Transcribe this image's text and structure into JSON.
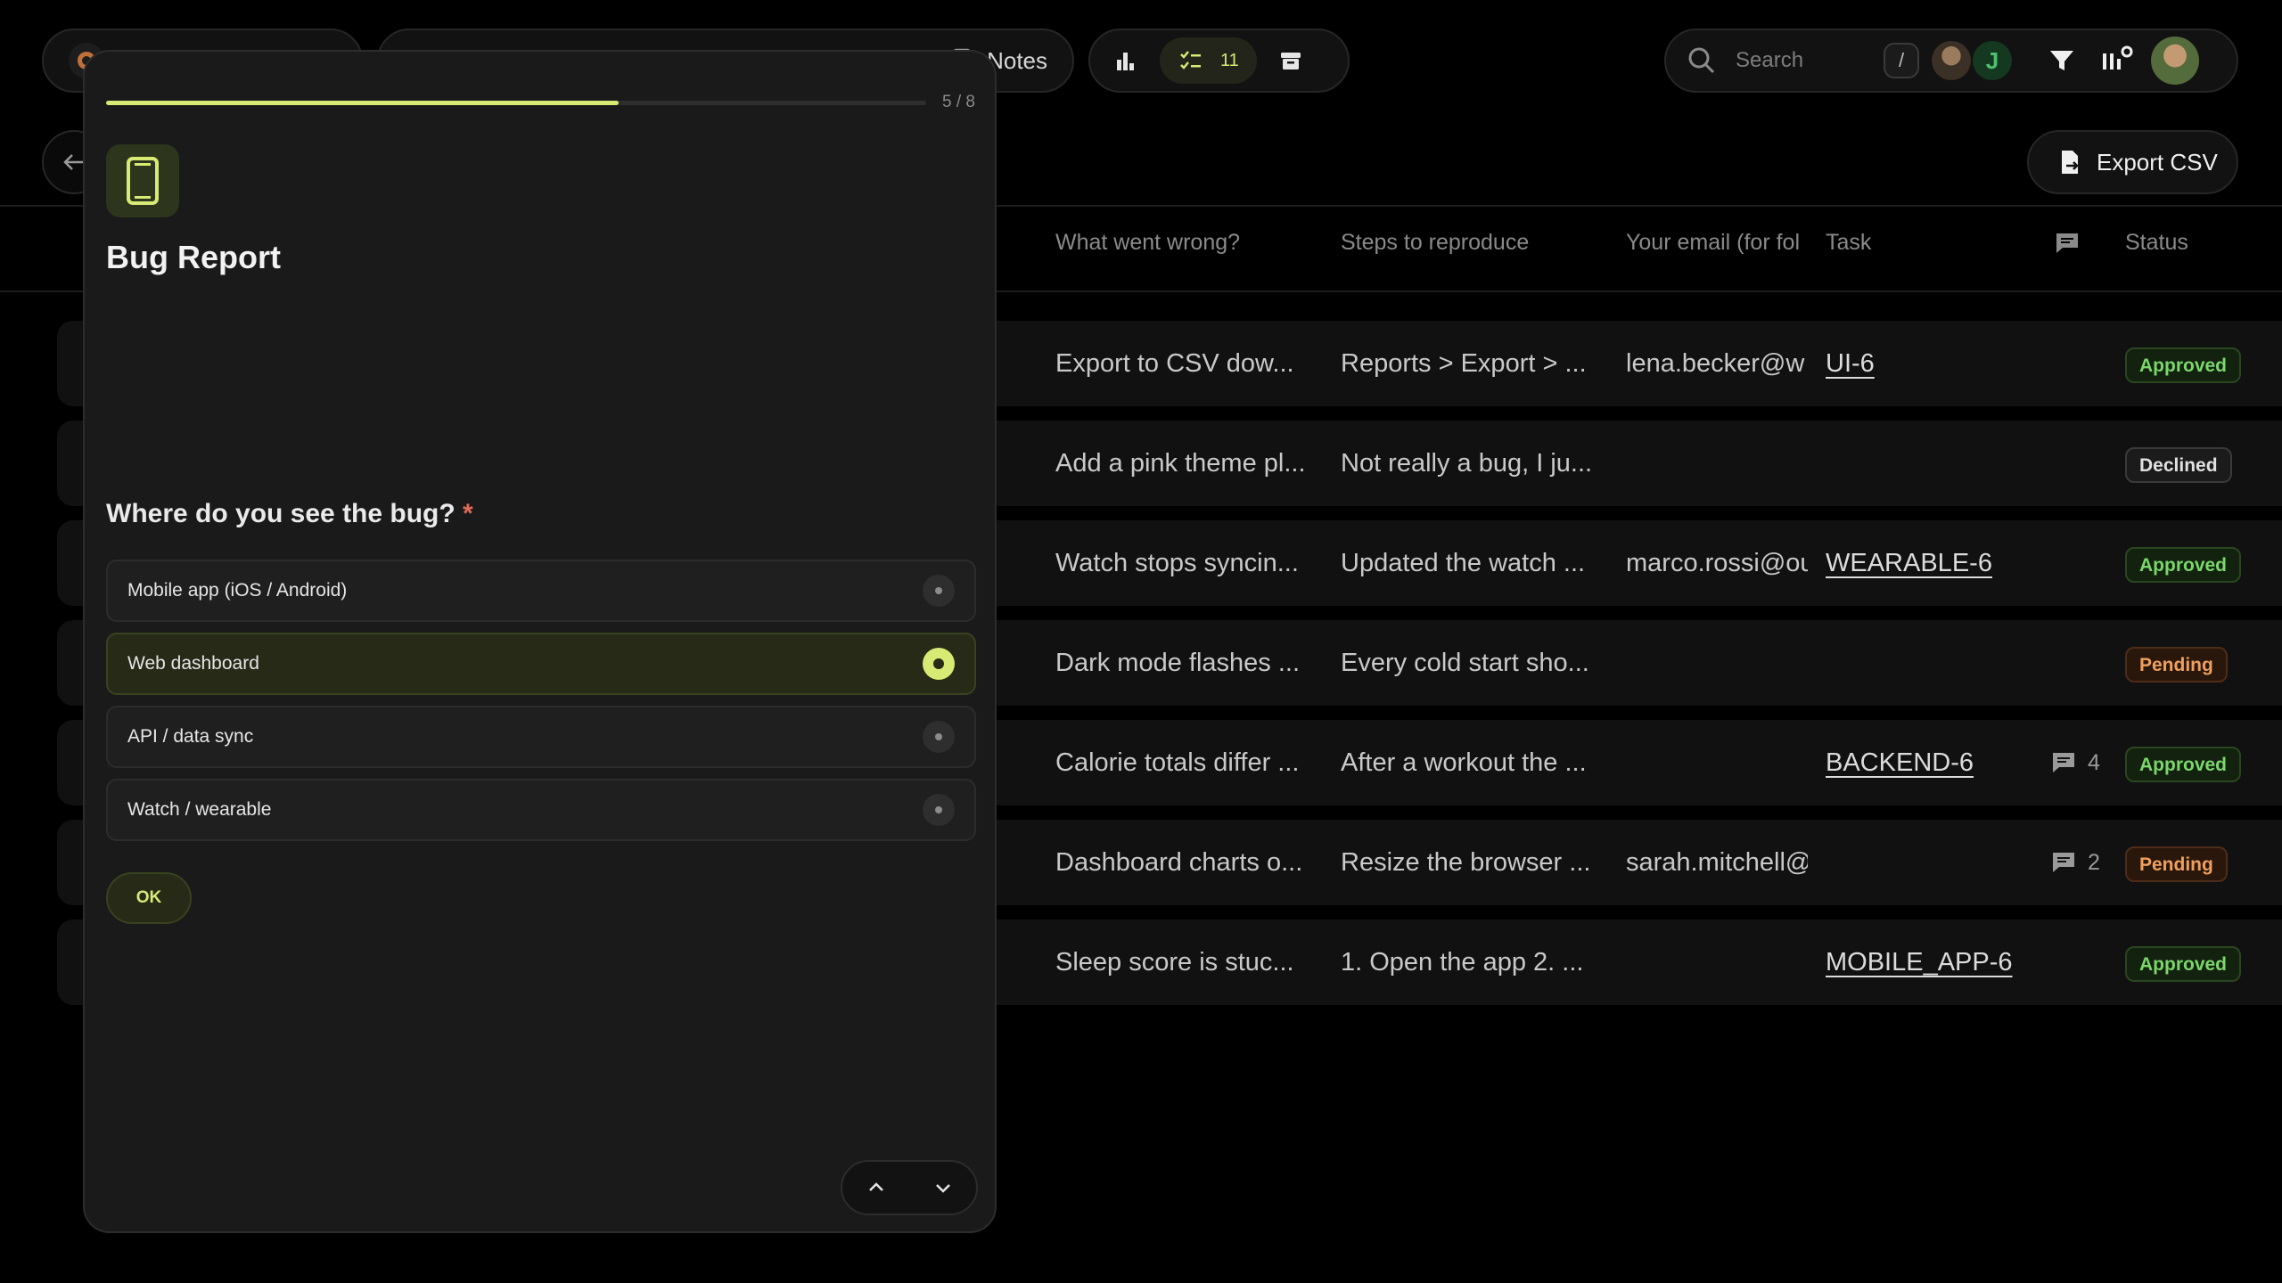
{
  "colors": {
    "accent": "#d7ea74",
    "background": "#000000",
    "panel": "#1a1a1a",
    "approved": "#7bd66b",
    "pending": "#f0a05c",
    "required": "#e16a5a"
  },
  "topbar": {
    "notes_label": "Notes",
    "count": "11",
    "search_placeholder": "Search",
    "search_shortcut": "/",
    "avatar_initial": "J"
  },
  "toolbar": {
    "export_label": "Export CSV"
  },
  "table": {
    "columns": [
      "What went wrong?",
      "Steps to reproduce",
      "Your email (for fol",
      "Task",
      "",
      "Status"
    ],
    "rows": [
      {
        "wrong": "Export to CSV dow...",
        "steps": "Reports > Export > ...",
        "email": "lena.becker@w",
        "task": "UI-6",
        "comments": "",
        "status": "Approved",
        "status_kind": "approved"
      },
      {
        "wrong": "Add a pink theme pl...",
        "steps": "Not really a bug, I ju...",
        "email": "",
        "task": "",
        "comments": "",
        "status": "Declined",
        "status_kind": "declined"
      },
      {
        "wrong": "Watch stops syncin...",
        "steps": "Updated the watch ...",
        "email": "marco.rossi@ou",
        "task": "WEARABLE-6",
        "comments": "",
        "status": "Approved",
        "status_kind": "approved"
      },
      {
        "wrong": "Dark mode flashes ...",
        "steps": "Every cold start sho...",
        "email": "",
        "task": "",
        "comments": "",
        "status": "Pending",
        "status_kind": "pending"
      },
      {
        "wrong": "Calorie totals differ ...",
        "steps": "After a workout the ...",
        "email": "",
        "task": "BACKEND-6",
        "comments": "4",
        "status": "Approved",
        "status_kind": "approved"
      },
      {
        "wrong": "Dashboard charts o...",
        "steps": "Resize the browser ...",
        "email": "sarah.mitchell@",
        "task": "",
        "comments": "2",
        "status": "Pending",
        "status_kind": "pending"
      },
      {
        "wrong": "Sleep score is stuc...",
        "steps": "1. Open the app 2. ...",
        "email": "",
        "task": "MOBILE_APP-6",
        "comments": "",
        "status": "Approved",
        "status_kind": "approved"
      }
    ]
  },
  "form": {
    "progress_label": "5 / 8",
    "progress_fraction": 0.625,
    "title": "Bug Report",
    "question": "Where do you see the bug?",
    "required_mark": "*",
    "options": [
      {
        "label": "Mobile app (iOS / Android)",
        "selected": false
      },
      {
        "label": "Web dashboard",
        "selected": true
      },
      {
        "label": "API / data sync",
        "selected": false
      },
      {
        "label": "Watch / wearable",
        "selected": false
      }
    ],
    "ok_label": "OK"
  },
  "icons": {
    "brand": "brand-logo-icon",
    "stats": "bar-chart-icon",
    "tasks": "checklist-icon",
    "archive": "archive-icon",
    "search": "search-icon",
    "filter": "filter-icon",
    "view_settings": "columns-settings-icon",
    "export": "file-export-icon",
    "back": "arrow-left-icon",
    "form": "smartphone-icon",
    "comment": "comment-icon",
    "prev": "chevron-up-icon",
    "next": "chevron-down-icon"
  }
}
